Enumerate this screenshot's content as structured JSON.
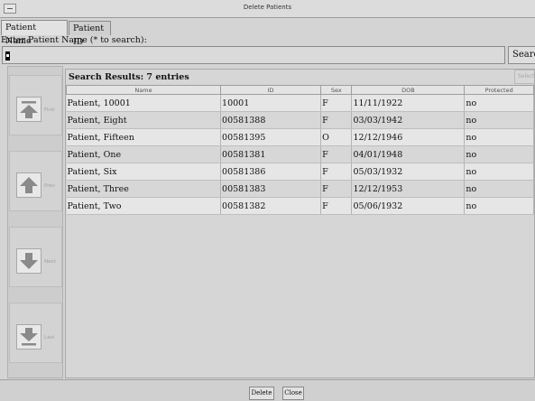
{
  "window": {
    "title": "Delete Patients"
  },
  "tabs": [
    {
      "label": "Patient Name",
      "active": true
    },
    {
      "label": "Patient ID",
      "active": false
    }
  ],
  "search": {
    "prompt": "Enter Patient Name (* to search):",
    "value": "",
    "button_label": "Search"
  },
  "nav": {
    "first": {
      "icon": "arrow-first-icon",
      "label": "First"
    },
    "prev": {
      "icon": "arrow-up-icon",
      "label": "Prev"
    },
    "next": {
      "icon": "arrow-down-icon",
      "label": "Next"
    },
    "last": {
      "icon": "arrow-last-icon",
      "label": "Last"
    }
  },
  "results": {
    "title": "Search Results: 7 entries",
    "select_label": "Select",
    "columns": [
      "Name",
      "ID",
      "Sex",
      "DOB",
      "Protected"
    ],
    "rows": [
      [
        "Patient, 10001",
        "10001",
        "F",
        "11/11/1922",
        "no"
      ],
      [
        "Patient, Eight",
        "00581388",
        "F",
        "03/03/1942",
        "no"
      ],
      [
        "Patient, Fifteen",
        "00581395",
        "O",
        "12/12/1946",
        "no"
      ],
      [
        "Patient, One",
        "00581381",
        "F",
        "04/01/1948",
        "no"
      ],
      [
        "Patient, Six",
        "00581386",
        "F",
        "05/03/1932",
        "no"
      ],
      [
        "Patient, Three",
        "00581383",
        "F",
        "12/12/1953",
        "no"
      ],
      [
        "Patient, Two",
        "00581382",
        "F",
        "05/06/1932",
        "no"
      ]
    ]
  },
  "footer": {
    "delete_label": "Delete",
    "close_label": "Close"
  },
  "colors": {
    "window_bg": "#d4d4d4",
    "row_light": "#e6e6e6",
    "row_dark": "#d7d7d7",
    "border": "#8a8a8a"
  }
}
